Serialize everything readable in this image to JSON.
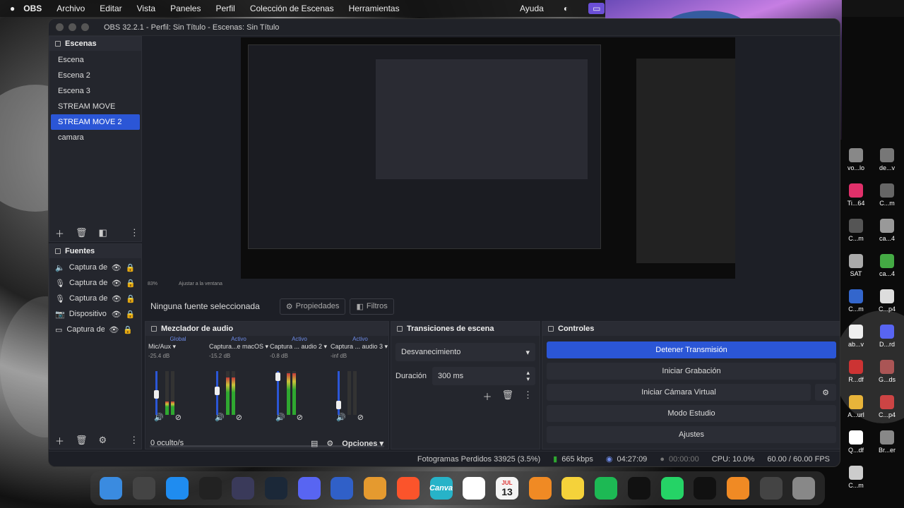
{
  "menubar": {
    "app": "OBS",
    "items": [
      "Archivo",
      "Editar",
      "Vista",
      "Paneles",
      "Perfil",
      "Colección de Escenas",
      "Herramientas"
    ],
    "help": "Ayuda"
  },
  "window": {
    "title": "OBS 32.2.1 - Perfil: Sin Título - Escenas: Sin Título"
  },
  "scenes": {
    "title": "Escenas",
    "items": [
      "Escena",
      "Escena 2",
      "Escena 3",
      "STREAM MOVE",
      "STREAM MOVE 2",
      "camara"
    ],
    "selected": "STREAM MOVE 2"
  },
  "sources": {
    "title": "Fuentes",
    "items": [
      {
        "name": "Captura de",
        "icon": "speaker-icon"
      },
      {
        "name": "Captura de",
        "icon": "mic-icon"
      },
      {
        "name": "Captura de",
        "icon": "mic-icon"
      },
      {
        "name": "Dispositivo",
        "icon": "camera-icon"
      },
      {
        "name": "Captura de",
        "icon": "monitor-icon"
      }
    ]
  },
  "props": {
    "none_selected": "Ninguna fuente seleccionada",
    "properties": "Propiedades",
    "filters": "Filtros"
  },
  "mixer": {
    "title": "Mezclador de audio",
    "channels": [
      {
        "status": "Global",
        "name": "Mic/Aux",
        "db": "-25.4 dB",
        "level": 0.3,
        "fader": 0.45
      },
      {
        "status": "Activo",
        "name": "Captura...e macOS",
        "db": "-15.2 dB",
        "level": 0.85,
        "fader": 0.55
      },
      {
        "status": "Activo",
        "name": "Captura ... audio 2",
        "db": "-0.8 dB",
        "level": 0.95,
        "fader": 0.95
      },
      {
        "status": "Activo",
        "name": "Captura ... audio 3",
        "db": "-inf dB",
        "level": 0.0,
        "fader": 0.15
      }
    ],
    "hidden": "0 oculto/s",
    "options": "Opciones"
  },
  "transitions": {
    "title": "Transiciones de escena",
    "selected": "Desvanecimiento",
    "duration_label": "Duración",
    "duration_value": "300 ms"
  },
  "controls": {
    "title": "Controles",
    "stop_stream": "Detener Transmisión",
    "start_rec": "Iniciar Grabación",
    "virtual_cam": "Iniciar Cámara Virtual",
    "studio": "Modo Estudio",
    "settings": "Ajustes"
  },
  "status": {
    "dropped": "Fotogramas Perdidos 33925 (3.5%)",
    "bitrate": "665 kbps",
    "stream_time": "04:27:09",
    "rec_time": "00:00:00",
    "cpu": "CPU: 10.0%",
    "fps": "60.00 / 60.00 FPS"
  },
  "preview": {
    "zoom": "83%",
    "fit": "Ajustar a la ventana"
  },
  "dock_icons": [
    "finder-icon",
    "launchpad-icon",
    "safari-icon",
    "unity-icon",
    "obs-icon",
    "steam-icon",
    "discord-icon",
    "box-icon",
    "photos-icon",
    "brave-icon",
    "canva-icon",
    "chrome-icon",
    "calendar-icon",
    "garageband-icon",
    "notes-icon",
    "spotify-icon",
    "capcut-icon",
    "whatsapp-icon",
    "terminal-icon",
    "app-icon",
    "folder-icon",
    "trash-icon"
  ],
  "calendar": {
    "month": "JUL",
    "day": "13"
  },
  "canva": "Canva",
  "desktop_labels": [
    "vo...lo",
    "de...v",
    "Ti...64",
    "C...m",
    "C...m",
    "ca...4",
    "SAT",
    "ca...4",
    "C...m",
    "C...p4",
    "ab...v",
    "D...rd",
    "R...df",
    "G...ds",
    "A...url",
    "C...p4",
    "Q...df",
    "Br...er",
    "C...m"
  ]
}
